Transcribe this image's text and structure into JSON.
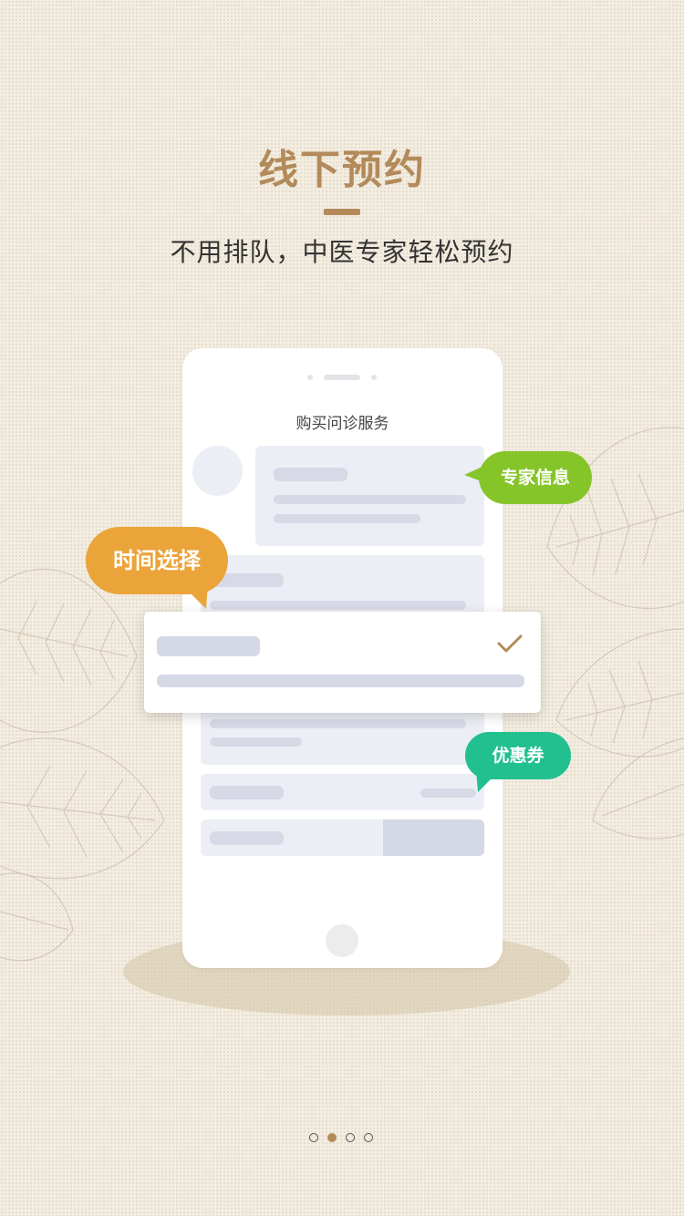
{
  "header": {
    "title": "线下预约",
    "subtitle": "不用排队，中医专家轻松预约"
  },
  "phone": {
    "screen_title": "购买问诊服务"
  },
  "bubbles": {
    "time_select": "时间选择",
    "expert_info": "专家信息",
    "coupon": "优惠券"
  },
  "pagination": {
    "total": 4,
    "active_index": 1
  },
  "colors": {
    "background": "#f3ede1",
    "accent": "#b38a5a",
    "time_bubble": "#eba43a",
    "expert_bubble": "#86c52a",
    "coupon_bubble": "#22c08f"
  },
  "icons": {
    "check": "check-icon",
    "decor": "leaf-illustration"
  }
}
